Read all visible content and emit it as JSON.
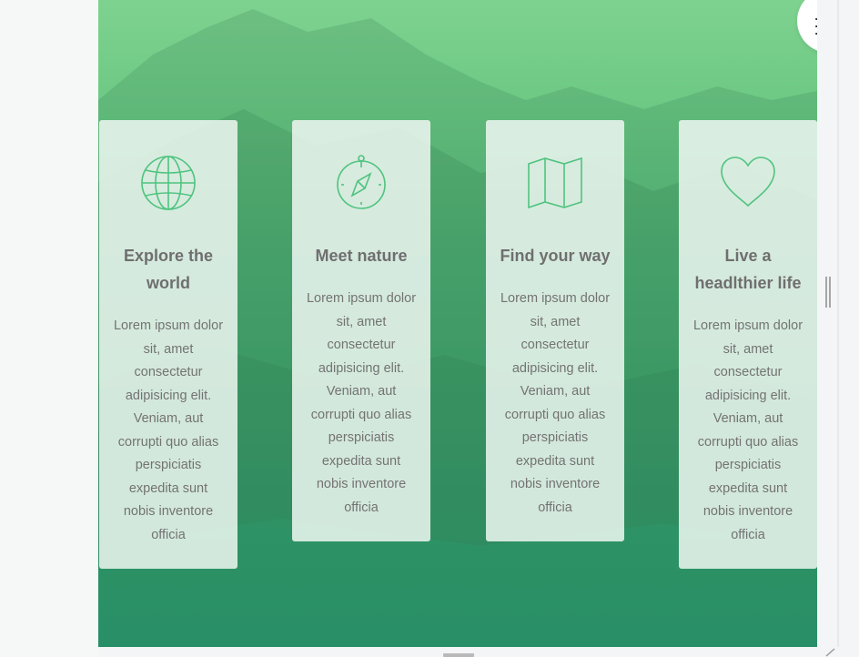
{
  "menu": {
    "icon": "hamburger-menu-icon"
  },
  "features": [
    {
      "icon": "globe-icon",
      "title": "Explore the world",
      "text": "Lorem ipsum dolor sit, amet consectetur adipisicing elit. Veniam, aut corrupti quo alias perspiciatis expedita sunt nobis inventore officia"
    },
    {
      "icon": "compass-icon",
      "title": "Meet nature",
      "text": "Lorem ipsum dolor sit, amet consectetur adipisicing elit. Veniam, aut corrupti quo alias perspiciatis expedita sunt nobis inventore officia"
    },
    {
      "icon": "map-icon",
      "title": "Find your way",
      "text": "Lorem ipsum dolor sit, amet consectetur adipisicing elit. Veniam, aut corrupti quo alias perspiciatis expedita sunt nobis inventore officia"
    },
    {
      "icon": "heart-icon",
      "title": "Live a headlthier life",
      "text": "Lorem ipsum dolor sit, amet consectetur adipisicing elit. Veniam, aut corrupti quo alias perspiciatis expedita sunt nobis inventore officia"
    }
  ],
  "colors": {
    "accent": "#4fc37f",
    "overlay_top": "#7ed28f",
    "overlay_bottom": "#2fa177"
  }
}
